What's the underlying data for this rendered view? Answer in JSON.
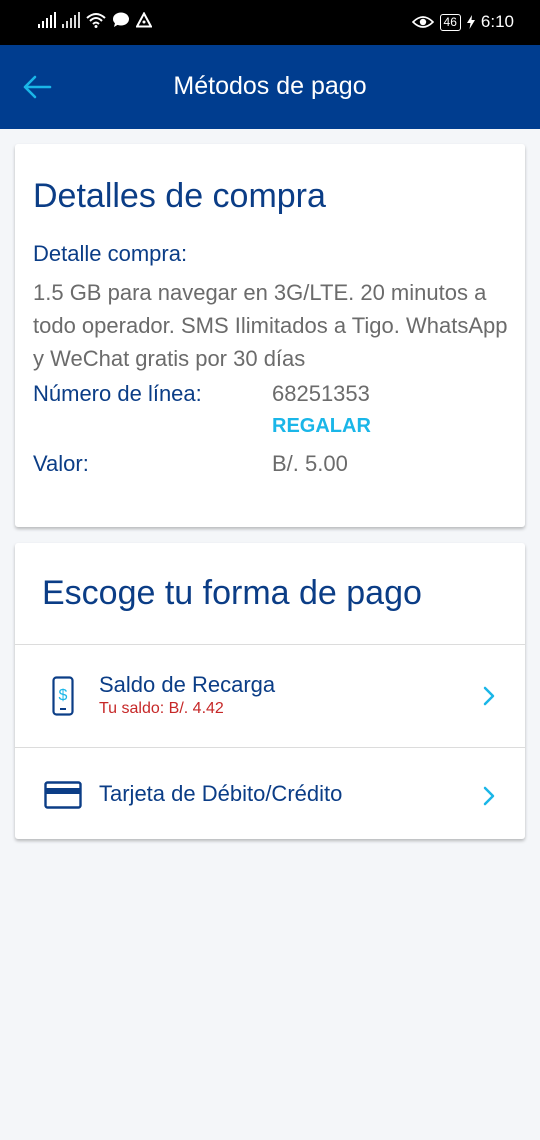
{
  "status_bar": {
    "battery": "46",
    "time": "6:10"
  },
  "app_bar": {
    "title": "Métodos de pago",
    "back_icon": "arrow-left-icon"
  },
  "purchase": {
    "title": "Detalles de compra",
    "detail_label": "Detalle compra:",
    "detail_text": "1.5 GB para navegar en 3G/LTE. 20 minutos a todo operador. SMS Ilimitados a Tigo. WhatsApp y WeChat gratis por 30 días",
    "line_label": "Número de línea:",
    "line_value": "68251353",
    "gift_link": "REGALAR",
    "amount_label": "Valor:",
    "amount_value": "B/. 5.00"
  },
  "payment": {
    "title": "Escoge tu forma de pago",
    "options": [
      {
        "icon": "phone-dollar-icon",
        "label": "Saldo de Recarga",
        "sub": "Tu saldo: B/. 4.42"
      },
      {
        "icon": "credit-card-icon",
        "label": "Tarjeta de Débito/Crédito"
      }
    ]
  },
  "colors": {
    "primary": "#003d8f",
    "text_blue": "#0b3d86",
    "accent": "#1ab6e8",
    "error": "#c62828",
    "background": "#f4f6f9"
  }
}
